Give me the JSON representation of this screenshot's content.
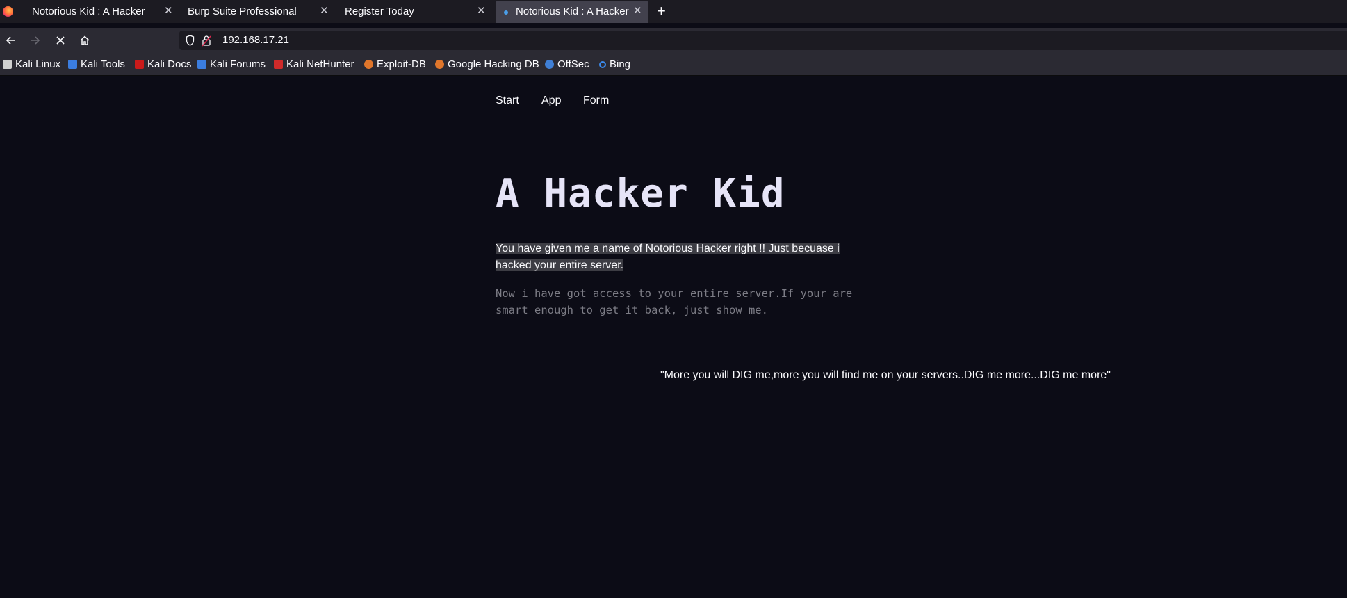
{
  "browser": {
    "tabs": [
      {
        "title": "Notorious Kid : A Hacker",
        "active": false
      },
      {
        "title": "Burp Suite Professional",
        "active": false
      },
      {
        "title": "Register Today",
        "active": false
      },
      {
        "title": "Notorious Kid : A Hacker",
        "active": true
      }
    ],
    "new_tab_label": "+",
    "close_glyph": "✕",
    "url": "192.168.17.21",
    "nav_icons": [
      "back-arrow-icon",
      "forward-arrow-icon",
      "stop-icon",
      "home-icon"
    ],
    "bookmarks": [
      {
        "label": "Kali Linux",
        "icon": "kali-dragon-icon",
        "color": "#d0d0d0"
      },
      {
        "label": "Kali Tools",
        "icon": "kali-tools-icon",
        "color": "#3b7de0"
      },
      {
        "label": "Kali Docs",
        "icon": "kali-docs-icon",
        "color": "#c91a1a"
      },
      {
        "label": "Kali Forums",
        "icon": "kali-forums-icon",
        "color": "#3b7de0"
      },
      {
        "label": "Kali NetHunter",
        "icon": "nethunter-icon",
        "color": "#d02a2a"
      },
      {
        "label": "Exploit-DB",
        "icon": "exploit-db-icon",
        "color": "#e0762b"
      },
      {
        "label": "Google Hacking DB",
        "icon": "ghdb-icon",
        "color": "#e0762b"
      },
      {
        "label": "OffSec",
        "icon": "offsec-icon",
        "color": "#3f7fd6"
      },
      {
        "label": "Bing",
        "icon": "bing-search-icon",
        "color": "#3b8cf0"
      }
    ]
  },
  "site": {
    "nav": [
      "Start",
      "App",
      "Form"
    ],
    "title": "A Hacker Kid",
    "intro": "You have given me a name of Notorious Hacker right !! Just becuase i hacked your entire server.",
    "paragraph": "Now i have got access to your entire server.If your are smart enough to get it back, just show me.",
    "quote": "\"More you will DIG me,more you will find me on your servers..DIG me more...DIG me more\""
  }
}
